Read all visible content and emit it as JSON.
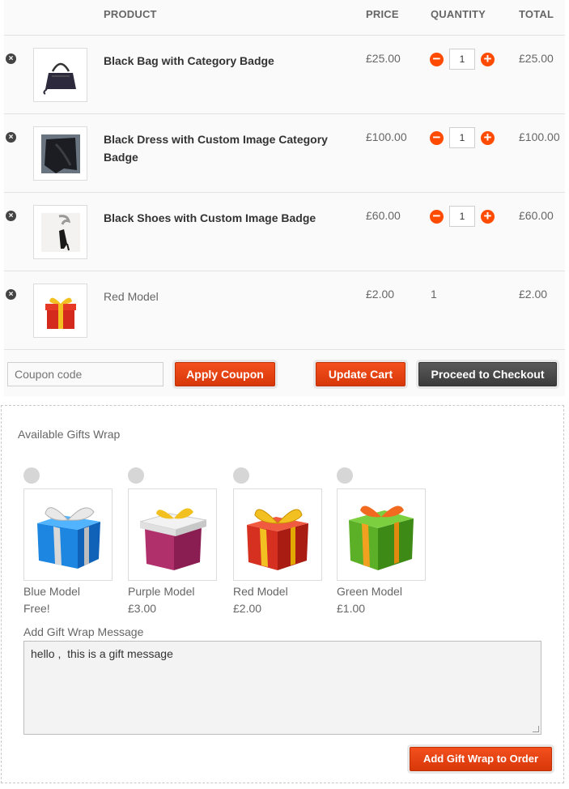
{
  "table": {
    "headers": {
      "product": "PRODUCT",
      "price": "PRICE",
      "quantity": "QUANTITY",
      "total": "TOTAL"
    }
  },
  "items": [
    {
      "name": "Black Bag with Category Badge",
      "price": "£25.00",
      "qty": "1",
      "total": "£25.00",
      "editable": true
    },
    {
      "name": "Black Dress with Custom Image Category Badge",
      "price": "£100.00",
      "qty": "1",
      "total": "£100.00",
      "editable": true
    },
    {
      "name": "Black Shoes with Custom Image Badge",
      "price": "£60.00",
      "qty": "1",
      "total": "£60.00",
      "editable": true
    },
    {
      "name": "Red Model",
      "price": "£2.00",
      "qty": "1",
      "total": "£2.00",
      "editable": false
    }
  ],
  "actions": {
    "coupon_placeholder": "Coupon code",
    "apply_coupon": "Apply Coupon",
    "update_cart": "Update Cart",
    "checkout": "Proceed to Checkout"
  },
  "gift_wrap": {
    "title": "Available Gifts Wrap",
    "options": [
      {
        "name": "Blue Model",
        "price": "Free!",
        "color": "#1e90e8"
      },
      {
        "name": "Purple Model",
        "price": "£3.00",
        "color": "#b0306b"
      },
      {
        "name": "Red Model",
        "price": "£2.00",
        "color": "#d63020"
      },
      {
        "name": "Green Model",
        "price": "£1.00",
        "color": "#4fa020"
      }
    ],
    "message_label": "Add Gift Wrap Message",
    "message_value": "hello ,  this is a gift message",
    "add_button": "Add Gift Wrap to Order"
  },
  "colors": {
    "accent": "#ff4b00",
    "dark_button": "#444444"
  }
}
